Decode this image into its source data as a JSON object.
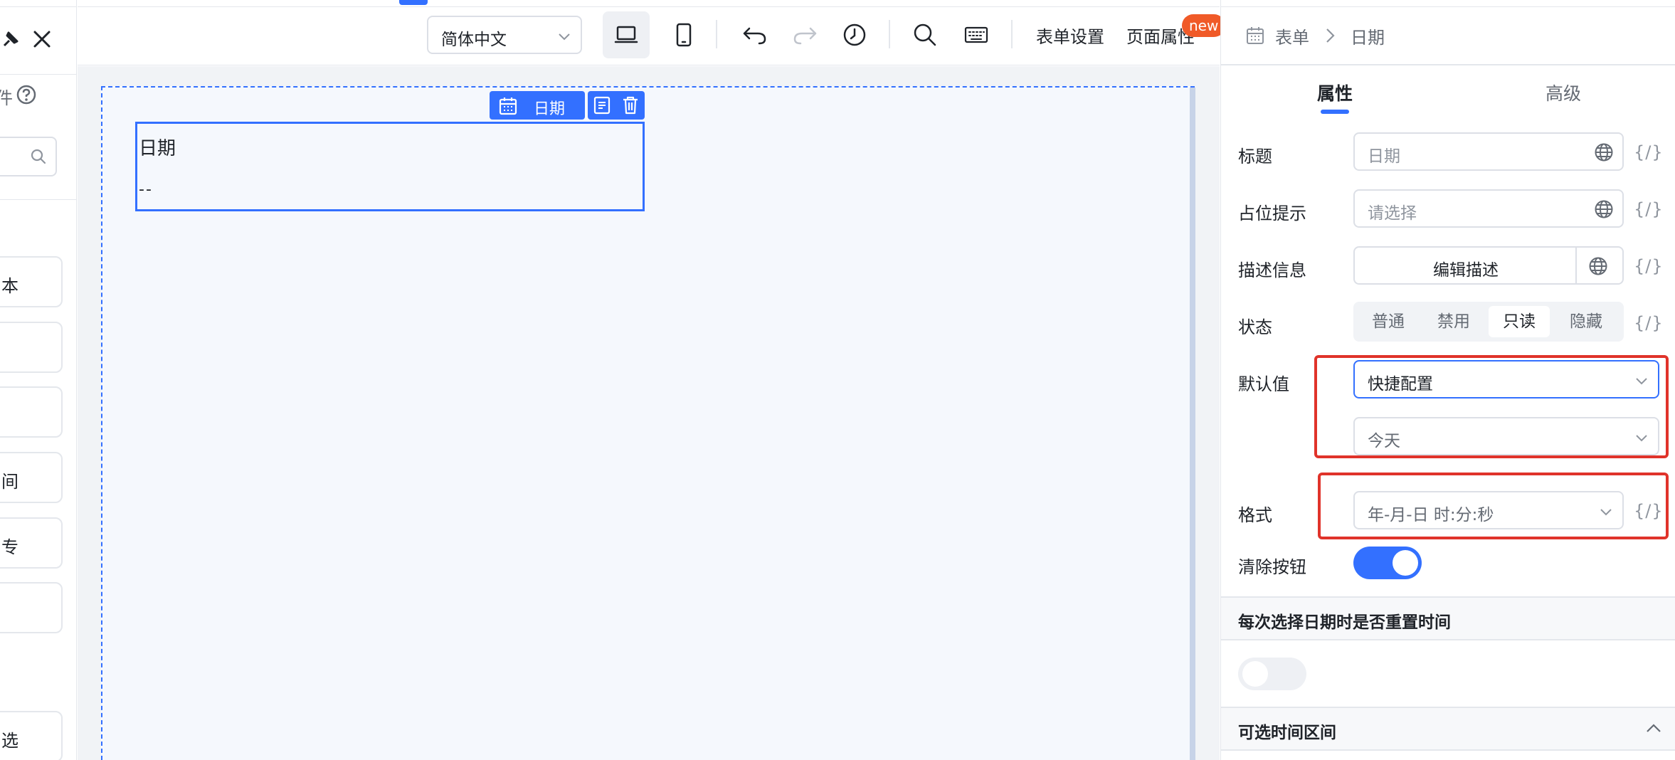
{
  "toolbar": {
    "language": "简体中文",
    "form_settings": "表单设置",
    "page_properties": "页面属性",
    "new_badge": "new"
  },
  "left_panel": {
    "header_suffix": "件",
    "items": [
      "本",
      "",
      "",
      "间",
      "专",
      "",
      "选"
    ]
  },
  "canvas": {
    "field_tag": "日期",
    "field_title": "日期",
    "field_value": "--"
  },
  "properties": {
    "breadcrumb": [
      "表单",
      "日期"
    ],
    "tabs": [
      "属性",
      "高级"
    ],
    "active_tab": "属性",
    "title_label": "标题",
    "title_value": "日期",
    "placeholder_label": "占位提示",
    "placeholder_value": "请选择",
    "description_label": "描述信息",
    "description_button": "编辑描述",
    "status_label": "状态",
    "status_options": [
      "普通",
      "禁用",
      "只读",
      "隐藏"
    ],
    "status_selected": "只读",
    "default_label": "默认值",
    "default_mode": "快捷配置",
    "default_value": "今天",
    "format_label": "格式",
    "format_value": "年-月-日 时:分:秒",
    "clear_button_label": "清除按钮",
    "clear_button_on": true,
    "reset_time_section": "每次选择日期时是否重置时间",
    "reset_time_on": false,
    "range_section": "可选时间区间",
    "code_symbol": "{/}"
  },
  "colors": {
    "accent": "#3370ff",
    "highlight_box": "#e0332a",
    "badge": "#f05a28"
  }
}
